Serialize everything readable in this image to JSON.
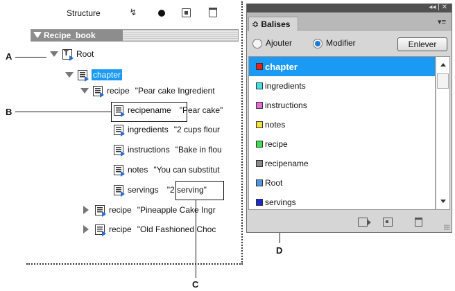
{
  "structure_pane": {
    "title": "Structure",
    "toolbar_icons": [
      "show-hide-attributes-icon",
      "add-attribute-icon",
      "new-element-icon",
      "delete-icon"
    ],
    "header_label": "Recipe_book",
    "tree": [
      {
        "name": "Root",
        "value": "",
        "state": "expanded"
      },
      {
        "name": "chapter",
        "value": "",
        "state": "expanded",
        "selected": true
      },
      {
        "name": "recipe",
        "value": "\"Pear cake Ingredient",
        "state": "expanded"
      },
      {
        "name": "recipename",
        "value": "\"Pear cake\"",
        "state": "leaf"
      },
      {
        "name": "ingredients",
        "value": "\"2 cups flour",
        "state": "leaf"
      },
      {
        "name": "instructions",
        "value": "\"Bake in flou",
        "state": "leaf"
      },
      {
        "name": "notes",
        "value": "\"You can substitut",
        "state": "leaf"
      },
      {
        "name": "servings",
        "value": "\"2 serving\"",
        "state": "leaf"
      },
      {
        "name": "recipe",
        "value": "\"Pineapple Cake Ingr",
        "state": "collapsed"
      },
      {
        "name": "recipe",
        "value": "\"Old Fashioned Choc",
        "state": "collapsed"
      }
    ]
  },
  "callouts": {
    "a": "A",
    "b": "B",
    "c": "C",
    "d": "D"
  },
  "tags_panel": {
    "titlebar_controls": "◂◂ | ✕",
    "tab_label": "≎ Balises",
    "menu_icon": "▾≡",
    "radio_add_label": "Ajouter",
    "radio_modify_label": "Modifier",
    "radio_selected": "Modifier",
    "remove_button_label": "Enlever",
    "tags": [
      {
        "name": "chapter",
        "color": "#e8201c",
        "selected": true
      },
      {
        "name": "ingredients",
        "color": "#3fe0e0"
      },
      {
        "name": "instructions",
        "color": "#e86ad6"
      },
      {
        "name": "notes",
        "color": "#f2e23a"
      },
      {
        "name": "recipe",
        "color": "#3ede4a"
      },
      {
        "name": "recipename",
        "color": "#8a8a8a"
      },
      {
        "name": "Root",
        "color": "#4f96e0"
      },
      {
        "name": "servings",
        "color": "#1c2ad6"
      }
    ],
    "bottom_icons": [
      "tag-content-icon",
      "new-tag-icon",
      "delete-tag-icon"
    ]
  },
  "colors": {
    "selection_blue": "#1a9af2",
    "panel_gray": "#d6d6d6"
  }
}
